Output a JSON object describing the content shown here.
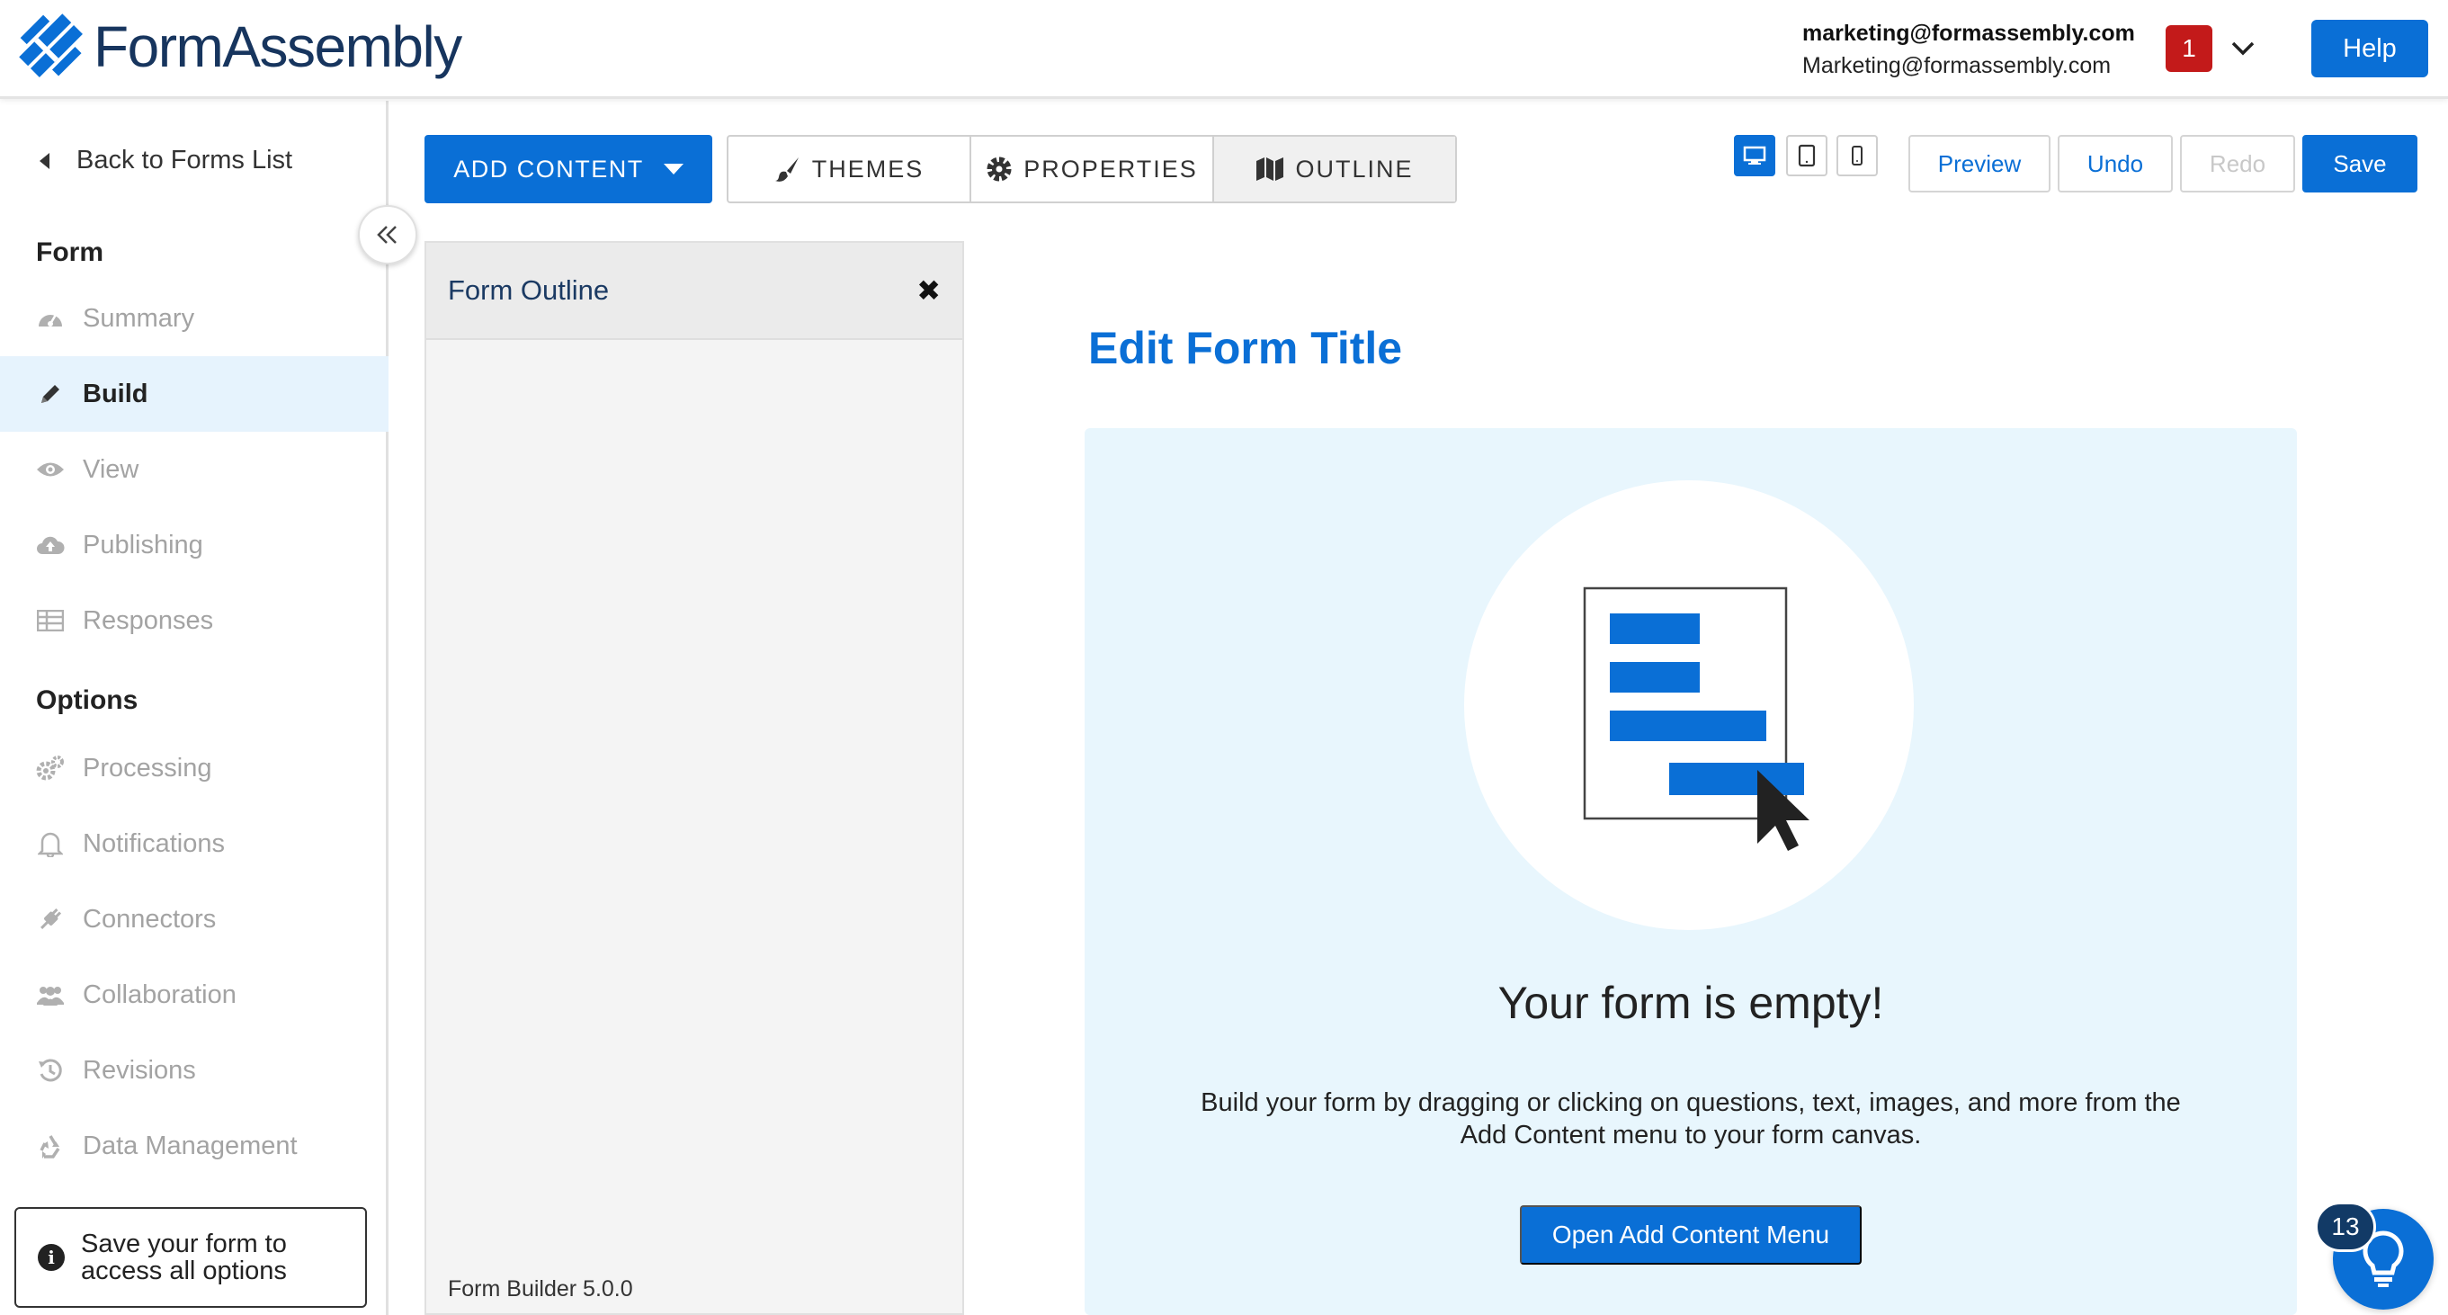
{
  "brand": {
    "name": "FormAssembly"
  },
  "header": {
    "user_email_bold": "marketing@formassembly.com",
    "user_email": "Marketing@formassembly.com",
    "notification_count": "1",
    "help_label": "Help"
  },
  "sidebar": {
    "back_label": "Back to Forms List",
    "form_section": "Form",
    "form_items": [
      {
        "label": "Summary",
        "icon": "dashboard-icon"
      },
      {
        "label": "Build",
        "icon": "pencil-icon",
        "active": true
      },
      {
        "label": "View",
        "icon": "eye-icon"
      },
      {
        "label": "Publishing",
        "icon": "cloud-upload-icon"
      },
      {
        "label": "Responses",
        "icon": "table-icon"
      }
    ],
    "options_section": "Options",
    "option_items": [
      {
        "label": "Processing",
        "icon": "gears-icon"
      },
      {
        "label": "Notifications",
        "icon": "bell-icon"
      },
      {
        "label": "Connectors",
        "icon": "plug-icon"
      },
      {
        "label": "Collaboration",
        "icon": "users-icon"
      },
      {
        "label": "Revisions",
        "icon": "history-icon"
      },
      {
        "label": "Data Management",
        "icon": "recycle-icon"
      }
    ],
    "save_note": "Save your form to access all options"
  },
  "toolbar": {
    "add_content": "ADD CONTENT",
    "tabs": [
      {
        "label": "THEMES",
        "icon": "brush-icon"
      },
      {
        "label": "PROPERTIES",
        "icon": "gear-icon"
      },
      {
        "label": "OUTLINE",
        "icon": "map-icon",
        "active": true
      }
    ],
    "devices": [
      "desktop-icon",
      "tablet-icon",
      "mobile-icon"
    ],
    "preview": "Preview",
    "undo": "Undo",
    "redo": "Redo",
    "save": "Save"
  },
  "outline": {
    "title": "Form Outline",
    "version": "Form Builder 5.0.0"
  },
  "canvas": {
    "form_title": "Edit Form Title",
    "empty_heading": "Your form is empty!",
    "empty_description": "Build your form by dragging or clicking on questions, text, images, and more from the Add Content menu to your form canvas.",
    "open_menu_label": "Open Add Content Menu"
  },
  "help_widget": {
    "count": "13"
  },
  "colors": {
    "accent": "#0a6fd6",
    "brand_navy": "#17355e",
    "badge_red": "#c31a1a",
    "active_nav_bg": "#e6f3fd",
    "canvas_bg": "#e8f6fd"
  }
}
